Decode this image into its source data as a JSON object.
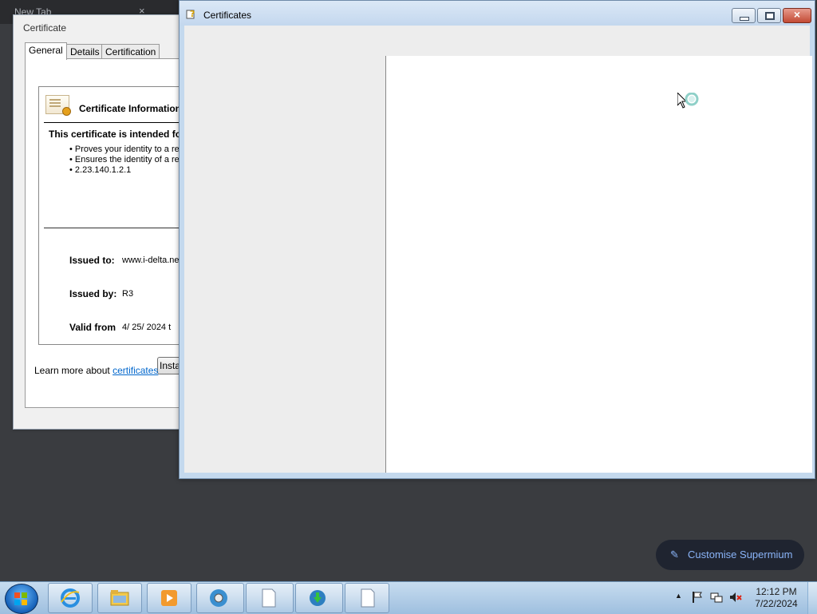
{
  "browser": {
    "tab_title": "New Tab",
    "tab_close": "×"
  },
  "certificate_dialog": {
    "title": "Certificate",
    "tabs": [
      "General",
      "Details",
      "Certification Path"
    ],
    "heading": "Certificate Information",
    "intended_label": "This certificate is intended for",
    "purposes": [
      "Proves your identity to a re",
      "Ensures the identity of a re",
      "2.23.140.1.2.1"
    ],
    "issued_to_label": "Issued to:",
    "issued_to_value": "www.i-delta.ne",
    "issued_by_label": "Issued by:",
    "issued_by_value": "R3",
    "valid_from_label": "Valid from",
    "valid_from_value": "4/ 25/ 2024  t",
    "install_button": "Insta",
    "learn_more_prefix": "Learn more about",
    "learn_more_link": "certificates"
  },
  "certificates_window": {
    "title": "Certificates",
    "minimize": "minimize",
    "maximize": "maximize",
    "close": "×"
  },
  "customise_button": {
    "label": "Customise Supermium",
    "icon": "pencil-icon"
  },
  "taskbar": {
    "apps": [
      "internet-explorer",
      "file-explorer",
      "media-player",
      "supermium-browser",
      "blank-document",
      "download-manager",
      "blank-document"
    ],
    "clock_time": "12:12 PM",
    "clock_date": "7/22/2024",
    "tray_icons": [
      "flag-icon",
      "network-icon",
      "volume-muted-icon"
    ]
  },
  "colors": {
    "link": "#0066cc",
    "customise_text": "#8ab4f8",
    "customise_bg": "#1f2430"
  }
}
